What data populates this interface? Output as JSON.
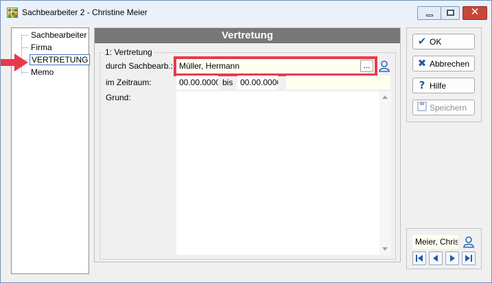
{
  "window": {
    "title": "Sachbearbeiter 2 - Christine Meier",
    "controls": [
      "minimize",
      "maximize",
      "close"
    ]
  },
  "tree": {
    "items": [
      {
        "label": "Sachbearbeiter",
        "selected": false
      },
      {
        "label": "Firma",
        "selected": false
      },
      {
        "label": "VERTRETUNG",
        "selected": true
      },
      {
        "label": "Memo",
        "selected": false
      }
    ]
  },
  "panel": {
    "title": "Vertretung",
    "group_title": "1: Vertretung",
    "by_label": "durch Sachbearb.:",
    "by_value": "Müller, Hermann",
    "browse_label": "...",
    "period_label": "im Zeitraum:",
    "date_from": "00.00.0000",
    "bis_label": "bis",
    "date_to": "00.00.0000",
    "reason_label": "Grund:",
    "reason_value": ""
  },
  "buttons": {
    "ok": "OK",
    "cancel": "Abbrechen",
    "help": "Hilfe",
    "save": "Speichern"
  },
  "navigator": {
    "current": "Meier, Chris"
  },
  "colors": {
    "header_bg": "#777777",
    "highlight": "#e83a4c",
    "field_bg": "#fffff0",
    "accent": "#2a5aa8"
  }
}
